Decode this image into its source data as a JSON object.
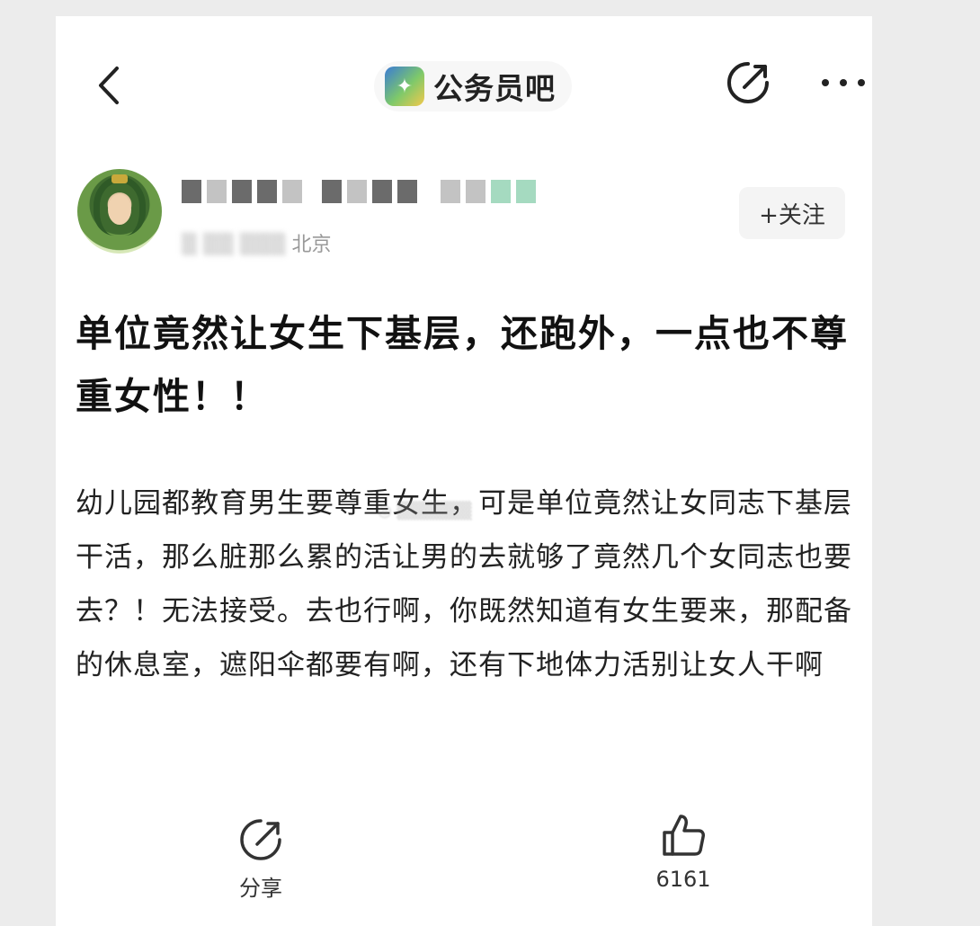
{
  "header": {
    "forum_name": "公务员吧"
  },
  "author": {
    "follow_label": "+关注",
    "location": "北京"
  },
  "post": {
    "title": "单位竟然让女生下基层，还跑外，一点也不尊重女性！！",
    "body": "幼儿园都教育男生要尊重女生，可是单位竟然让女同志下基层干活，那么脏那么累的活让男的去就够了竟然几个女同志也要去？！无法接受。去也行啊，你既然知道有女生要来，那配备的休息室，遮阳伞都要有啊，还有下地体力活别让女人干啊"
  },
  "footer": {
    "share_label": "分享",
    "like_count": "6161"
  },
  "icons": {
    "back": "chevron-left-icon",
    "edit": "edit-icon",
    "more": "more-icon",
    "share": "share-icon",
    "like": "thumbs-up-icon"
  }
}
